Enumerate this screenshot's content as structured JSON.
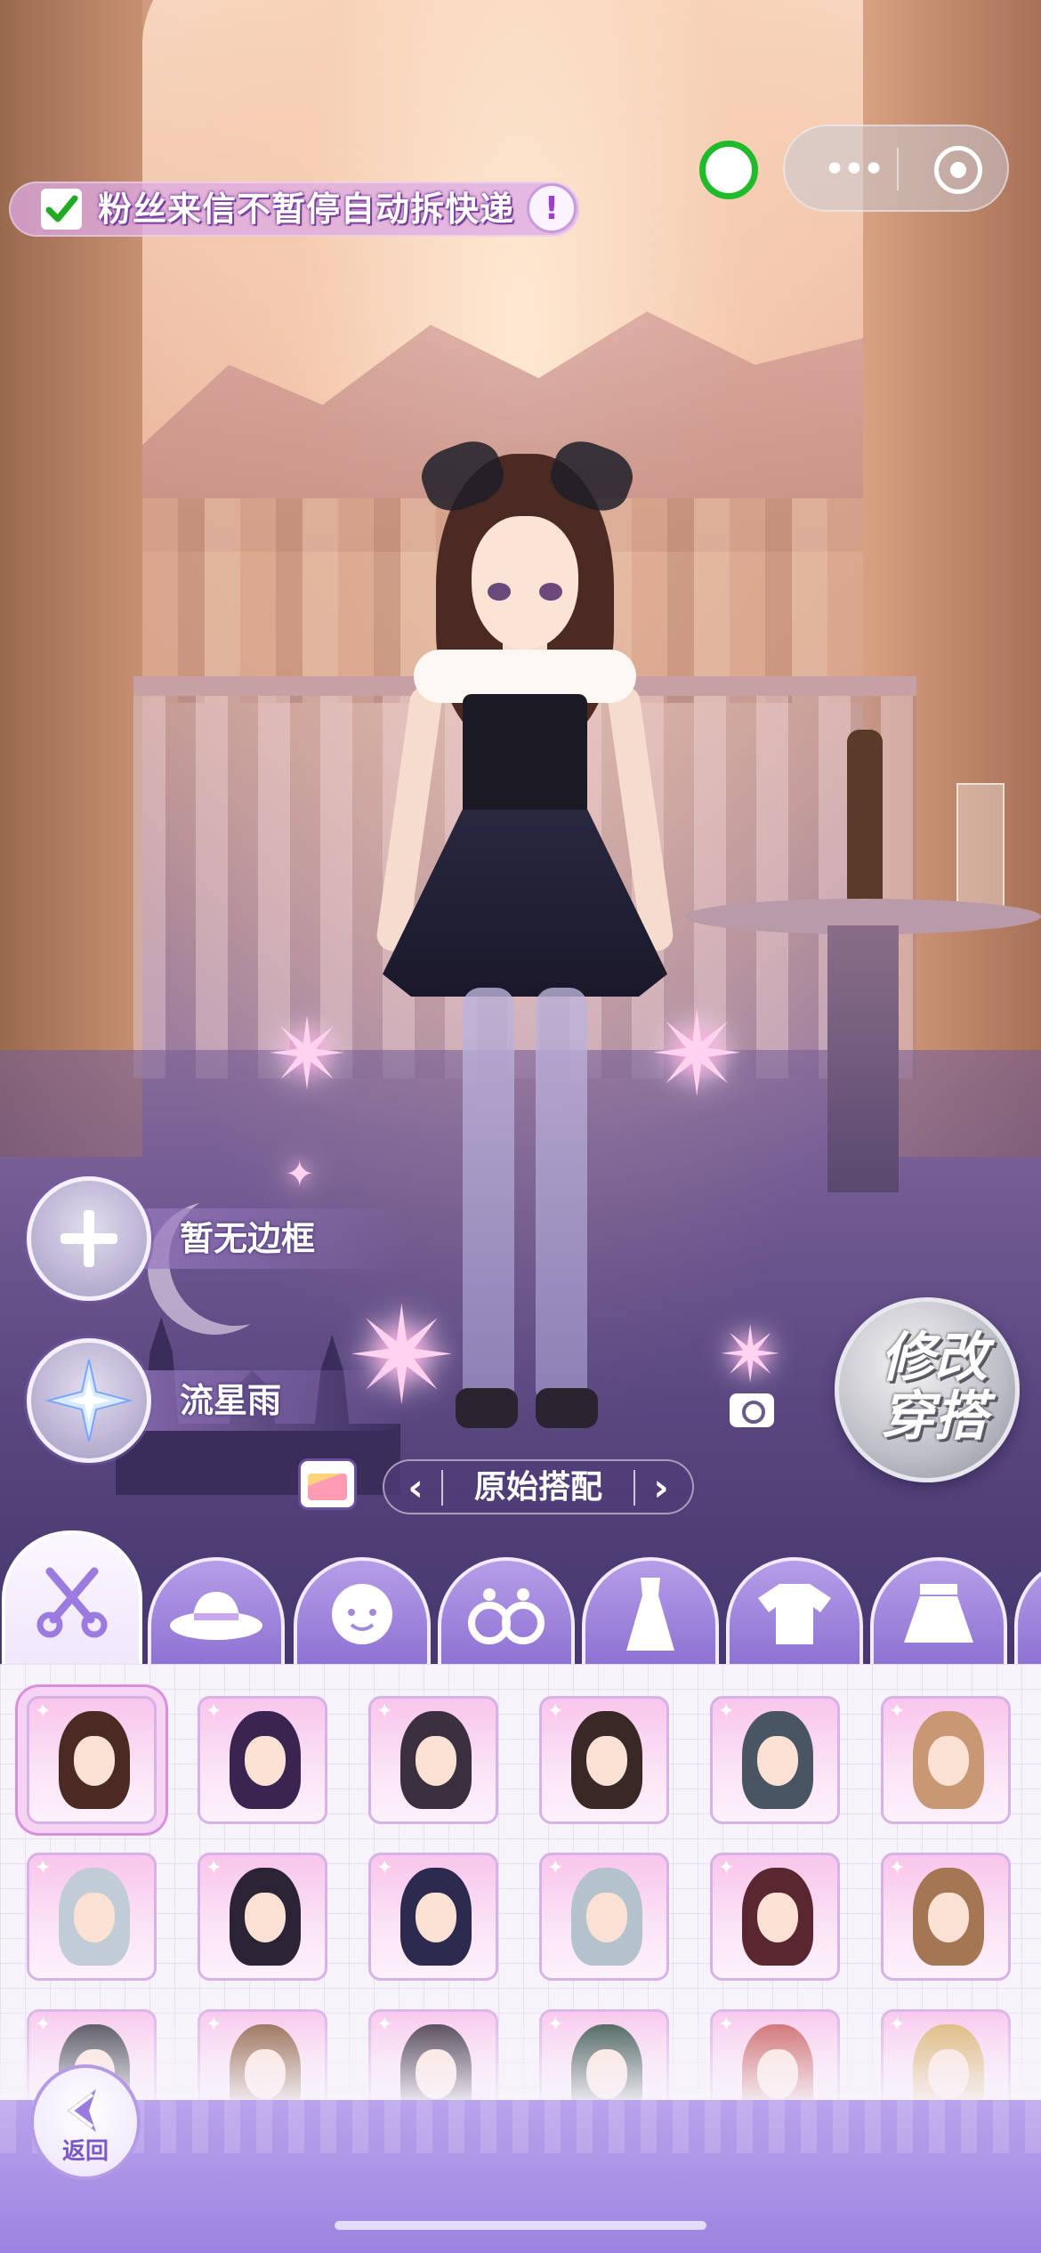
{
  "notice": {
    "checked": true,
    "text": "粉丝来信不暂停自动拆快递",
    "info_icon": "info-icon",
    "info_glyph": "!"
  },
  "capsule": {
    "more_icon": "more-dots-icon",
    "close_icon": "miniprogram-close-icon",
    "more_glyph": "•••"
  },
  "side": {
    "frame_label": "暂无边框",
    "effect_label": "流星雨",
    "frame_icon": "plus-icon",
    "effect_icon": "snowflake-star-icon"
  },
  "outfit": {
    "label": "原始搭配",
    "prev_glyph": "‹",
    "next_glyph": "›"
  },
  "modify_button": {
    "label": "修改\n穿搭"
  },
  "tabs": [
    {
      "icon": "hair-scissors-icon",
      "active": true
    },
    {
      "icon": "hat-icon",
      "active": false
    },
    {
      "icon": "face-icon",
      "active": false
    },
    {
      "icon": "earrings-icon",
      "active": false
    },
    {
      "icon": "dress-icon",
      "active": false
    },
    {
      "icon": "top-shirt-icon",
      "active": false
    },
    {
      "icon": "skirt-icon",
      "active": false
    }
  ],
  "hair_items": [
    {
      "color": "#4a2a22",
      "selected": true
    },
    {
      "color": "#3a2450",
      "selected": false
    },
    {
      "color": "#3b3040",
      "selected": false
    },
    {
      "color": "#3a2826",
      "selected": false
    },
    {
      "color": "#4a5564",
      "selected": false
    },
    {
      "color": "#c79873",
      "selected": false
    },
    {
      "color": "#c2ccd6",
      "selected": false
    },
    {
      "color": "#2a2436",
      "selected": false
    },
    {
      "color": "#2c2a4e",
      "selected": false
    },
    {
      "color": "#b4c2ce",
      "selected": false
    },
    {
      "color": "#5a2630",
      "selected": false
    },
    {
      "color": "#a47654",
      "selected": false
    },
    {
      "color": "#3a3a44",
      "selected": false
    },
    {
      "color": "#8a5a3a",
      "selected": false
    },
    {
      "color": "#34283a",
      "selected": false
    },
    {
      "color": "#2e4a42",
      "selected": false
    },
    {
      "color": "#c85a5a",
      "selected": false
    },
    {
      "color": "#d9b06a",
      "selected": false
    }
  ],
  "back_button": {
    "label": "返回",
    "icon": "back-arrow-icon"
  },
  "colors": {
    "accent": "#9b84e0",
    "check": "#22aa22",
    "wechat_green": "#1fbb2a"
  }
}
